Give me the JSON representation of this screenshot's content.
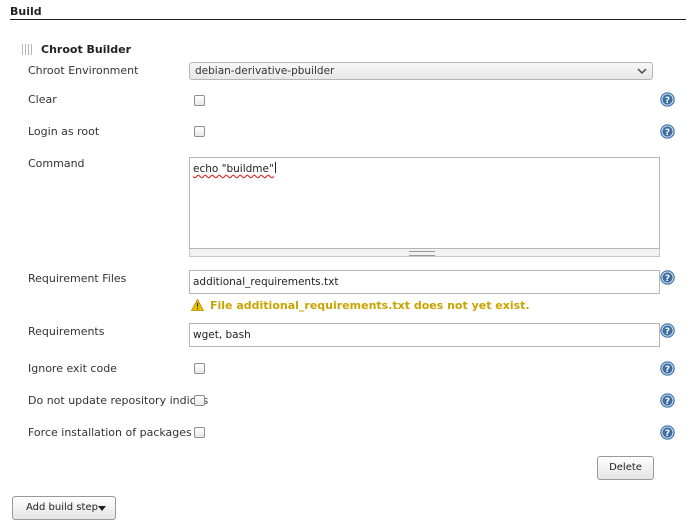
{
  "section": {
    "title": "Build"
  },
  "builder": {
    "title": "Chroot Builder",
    "chroot_environment": {
      "label": "Chroot Environment",
      "selected": "debian-derivative-pbuilder"
    },
    "clear": {
      "label": "Clear",
      "checked": false
    },
    "login_as_root": {
      "label": "Login as root",
      "checked": false
    },
    "command": {
      "label": "Command",
      "value": "echo \"buildme\""
    },
    "requirement_files": {
      "label": "Requirement Files",
      "value": "additional_requirements.txt",
      "warning": "File additional_requirements.txt does not yet exist."
    },
    "requirements": {
      "label": "Requirements",
      "value": "wget, bash"
    },
    "ignore_exit_code": {
      "label": "Ignore exit code",
      "checked": false
    },
    "no_update_indices": {
      "label": "Do not update repository indices",
      "checked": false
    },
    "force_install": {
      "label": "Force installation of packages",
      "checked": false
    },
    "delete_label": "Delete"
  },
  "add_build_step_label": "Add build step",
  "colors": {
    "warning": "#c8a400",
    "help_icon": "#4a7fb5",
    "rule": "#222222"
  },
  "icons": {
    "help": "help-icon",
    "warning": "warning-icon",
    "dropdown": "chevron-down-icon",
    "handle": "drag-handle-icon"
  }
}
